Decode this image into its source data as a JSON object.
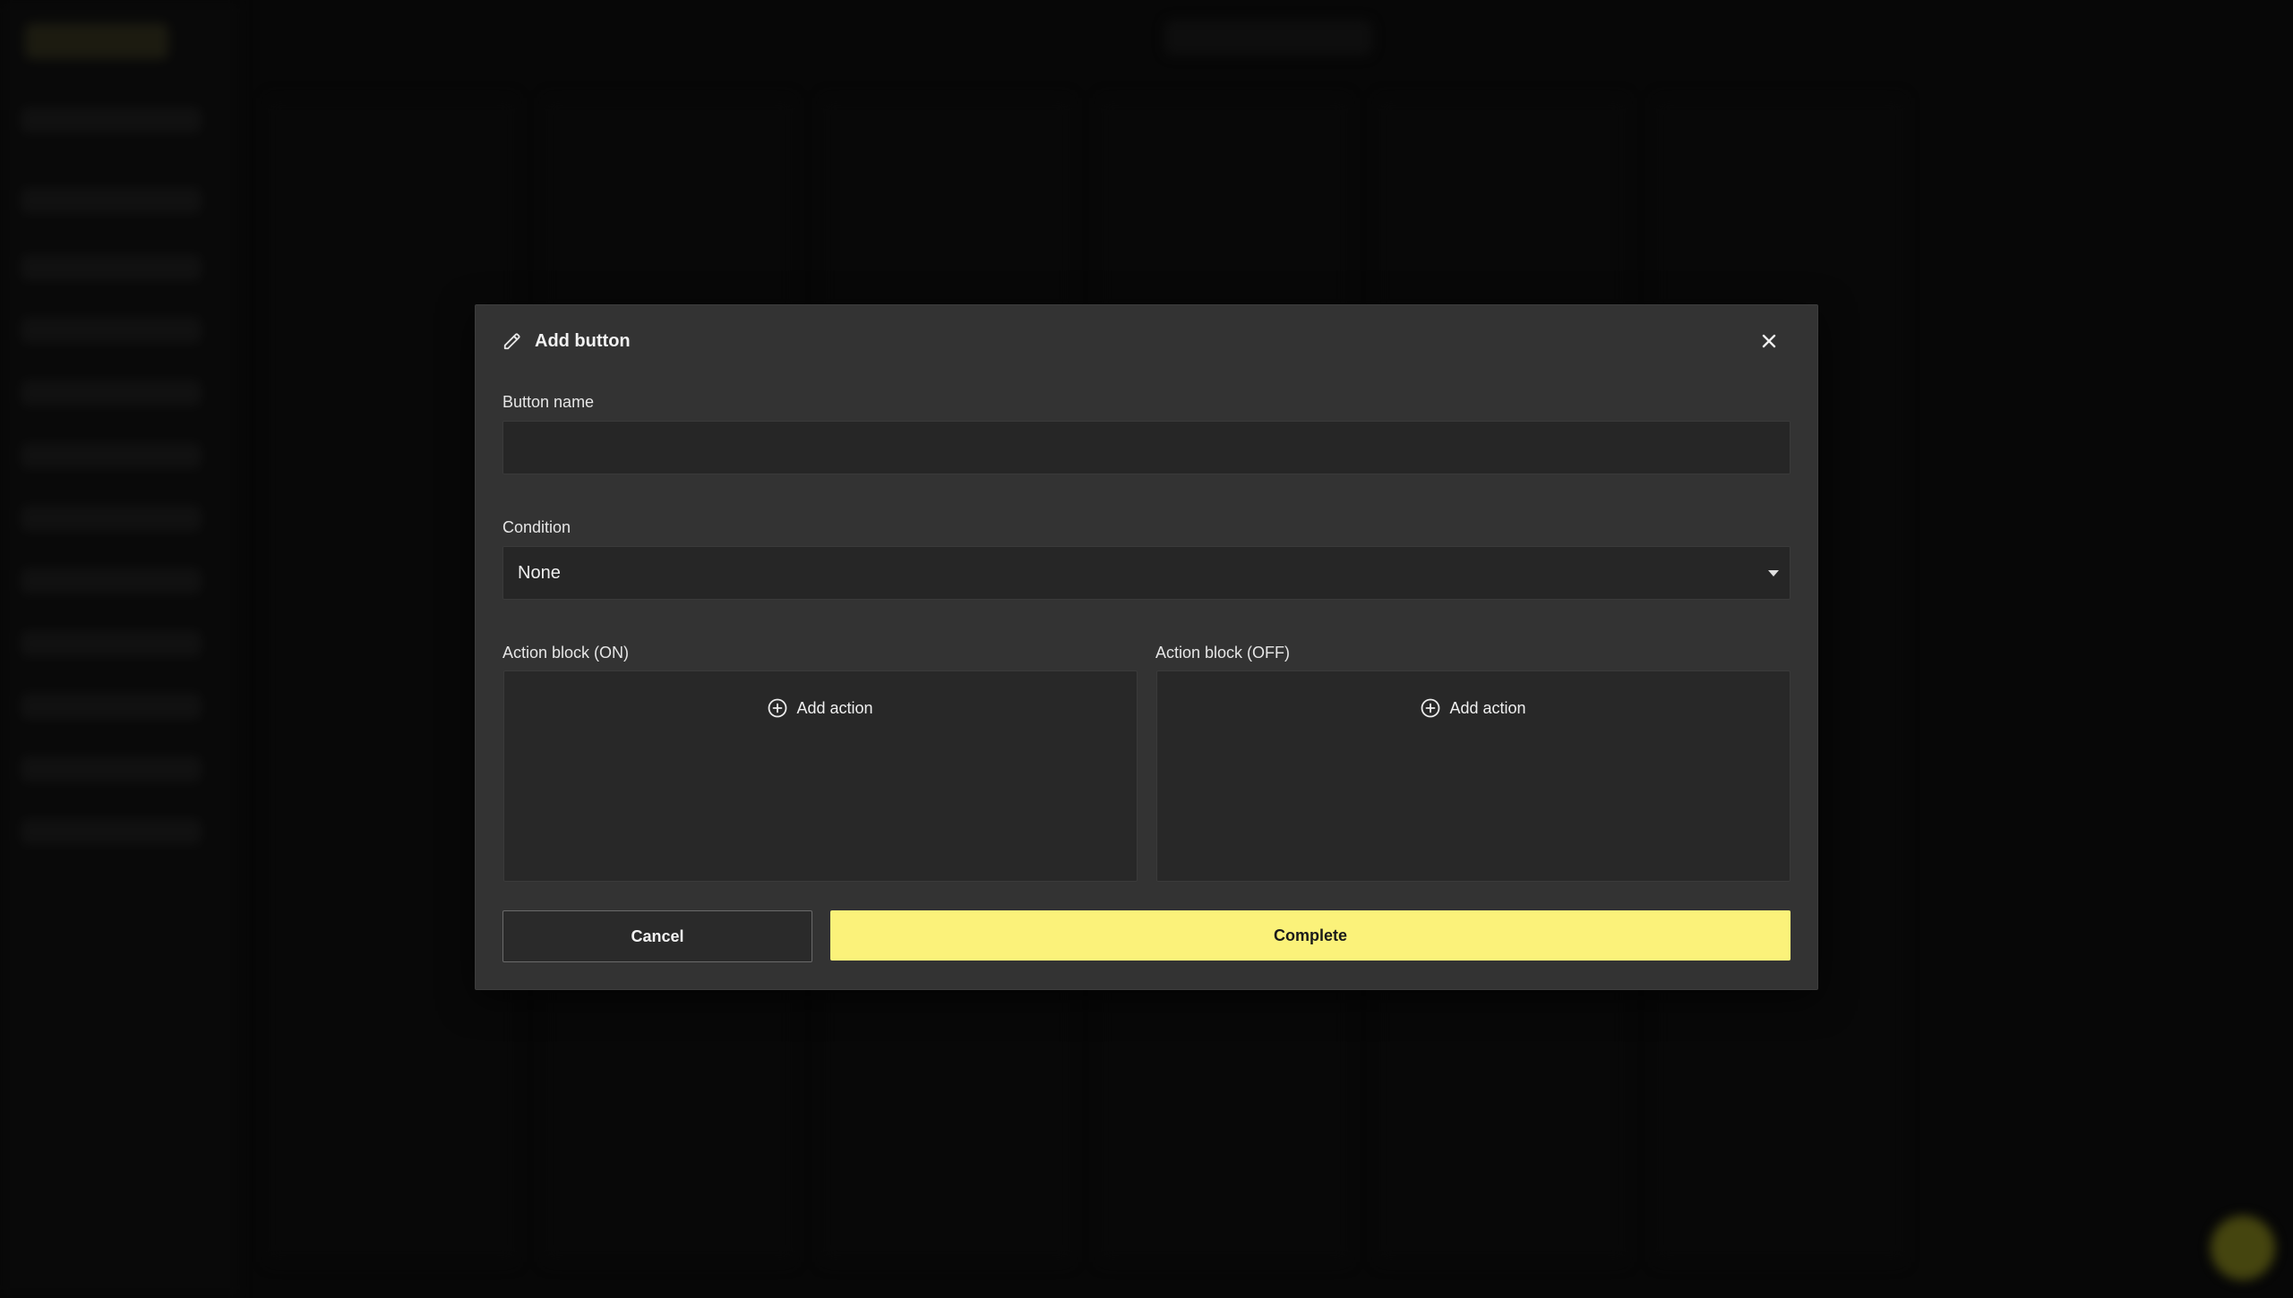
{
  "dialog": {
    "title": "Add button",
    "fields": {
      "button_name": {
        "label": "Button name",
        "value": "",
        "placeholder": ""
      },
      "condition": {
        "label": "Condition",
        "selected": "None"
      }
    },
    "action_blocks": [
      {
        "label": "Action block (ON)",
        "add_label": "Add action"
      },
      {
        "label": "Action block (OFF)",
        "add_label": "Add action"
      }
    ],
    "buttons": {
      "cancel": "Cancel",
      "complete": "Complete"
    }
  },
  "colors": {
    "dialog_bg": "#333333",
    "input_bg": "#262626",
    "accent": "#fbf27a",
    "backdrop": "#0b0b0b"
  },
  "icons": {
    "title": "pencil-icon",
    "close": "close-icon",
    "add": "plus-circle-icon",
    "dropdown": "caret-down-icon"
  }
}
